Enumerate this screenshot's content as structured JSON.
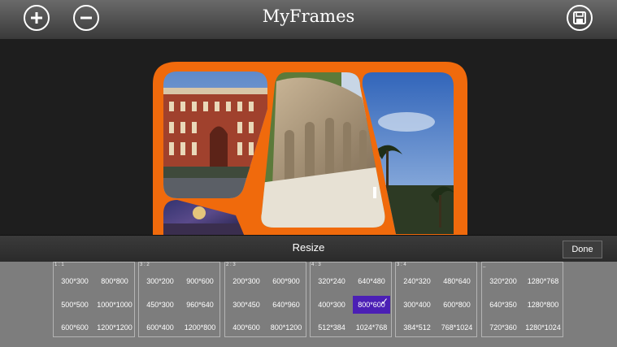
{
  "app": {
    "title": "MyFrames"
  },
  "toolbar": {
    "add_icon": "plus-circle-icon",
    "remove_icon": "minus-circle-icon",
    "save_icon": "floppy-disk-icon"
  },
  "colors": {
    "frame_orange": "#f06a0c",
    "selected": "#4b1fb5"
  },
  "resize": {
    "title": "Resize",
    "done_label": "Done",
    "groups": [
      {
        "label": "1 : 1",
        "options": [
          "300*300",
          "800*800",
          "500*500",
          "1000*1000",
          "600*600",
          "1200*1200"
        ]
      },
      {
        "label": "3 : 2",
        "options": [
          "300*200",
          "900*600",
          "450*300",
          "960*640",
          "600*400",
          "1200*800"
        ]
      },
      {
        "label": "2 : 3",
        "options": [
          "200*300",
          "600*900",
          "300*450",
          "640*960",
          "400*600",
          "800*1200"
        ]
      },
      {
        "label": "4 : 3",
        "options": [
          "320*240",
          "640*480",
          "400*300",
          "800*600",
          "512*384",
          "1024*768"
        ]
      },
      {
        "label": "3 : 4",
        "options": [
          "240*320",
          "480*640",
          "300*400",
          "600*800",
          "384*512",
          "768*1024"
        ]
      },
      {
        "label": "_",
        "options": [
          "320*200",
          "1280*768",
          "640*350",
          "1280*800",
          "720*360",
          "1280*1024"
        ]
      }
    ],
    "selected": "800*600"
  }
}
